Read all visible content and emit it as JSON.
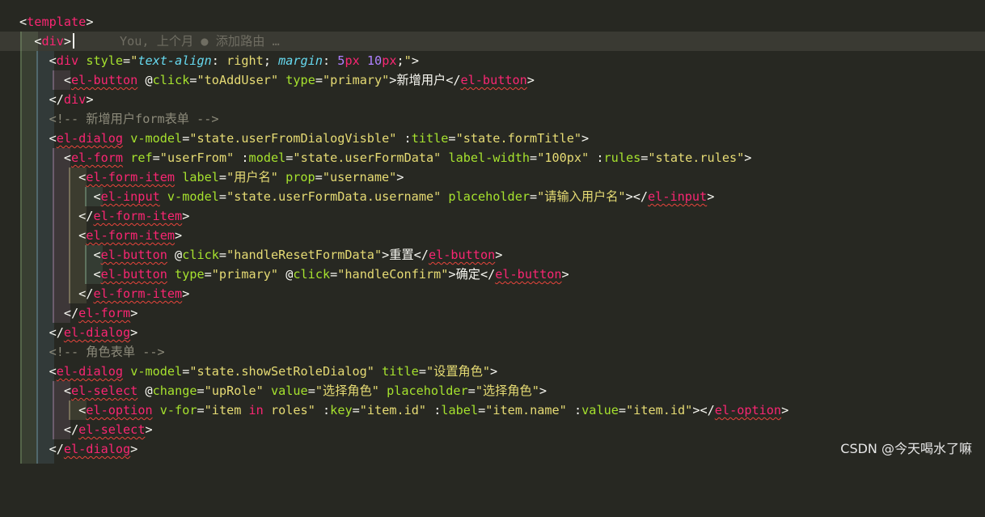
{
  "editor": {
    "language": "vue",
    "theme_colors": {
      "background": "#272822",
      "tag": "#f92672",
      "attribute": "#a6e22e",
      "string": "#e6db74",
      "number": "#ae81ff",
      "css_property": "#66d9ef",
      "comment": "#8c8a7a",
      "text": "#f8f8f2",
      "error_squiggle": "#e8453c"
    },
    "git_lens_annotation": "You, 上个月 ● 添加路由 …",
    "lines": [
      "<template>",
      "  <div>",
      "    <div style=\"text-align: right; margin: 5px 10px;\">",
      "      <el-button @click=\"toAddUser\" type=\"primary\">新增用户</el-button>",
      "    </div>",
      "    <!-- 新增用户form表单 -->",
      "    <el-dialog v-model=\"state.userFromDialogVisble\" :title=\"state.formTitle\">",
      "      <el-form ref=\"userFrom\" :model=\"state.userFormData\" label-width=\"100px\" :rules=\"state.rules\">",
      "        <el-form-item label=\"用户名\" prop=\"username\">",
      "          <el-input v-model=\"state.userFormData.username\" placeholder=\"请输入用户名\"></el-input>",
      "        </el-form-item>",
      "        <el-form-item>",
      "          <el-button @click=\"handleResetFormData\">重置</el-button>",
      "          <el-button type=\"primary\" @click=\"handleConfirm\">确定</el-button>",
      "        </el-form-item>",
      "      </el-form>",
      "    </el-dialog>",
      "    <!-- 角色表单 -->",
      "    <el-dialog v-model=\"state.showSetRoleDialog\" title=\"设置角色\">",
      "      <el-select @change=\"upRole\" value=\"选择角色\" placeholder=\"选择角色\">",
      "        <el-option v-for=\"item in roles\" :key=\"item.id\" :label=\"item.name\" :value=\"item.id\"></el-option>",
      "      </el-select>",
      "    </el-dialog>"
    ],
    "current_line_index": 1
  },
  "watermark": "CSDN @今天喝水了嘛"
}
